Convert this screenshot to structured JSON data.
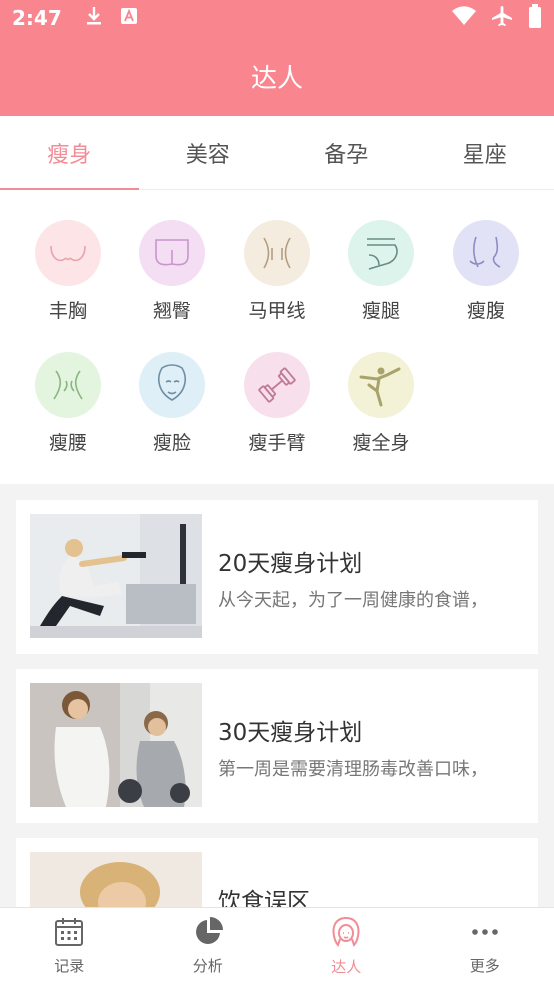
{
  "status_bar": {
    "time": "2:47",
    "icons": [
      "download-icon",
      "a-badge-icon",
      "wifi-icon",
      "airplane-icon",
      "battery-icon"
    ]
  },
  "app_bar": {
    "title": "达人"
  },
  "tabs": [
    {
      "label": "瘦身",
      "active": true
    },
    {
      "label": "美容",
      "active": false
    },
    {
      "label": "备孕",
      "active": false
    },
    {
      "label": "星座",
      "active": false
    }
  ],
  "categories": [
    {
      "label": "丰胸",
      "icon": "chest-icon",
      "color": "#fde4e7"
    },
    {
      "label": "翘臀",
      "icon": "hip-icon",
      "color": "#f3def4"
    },
    {
      "label": "马甲线",
      "icon": "abs-line-icon",
      "color": "#f5ece0"
    },
    {
      "label": "瘦腿",
      "icon": "leg-icon",
      "color": "#ddf4ec"
    },
    {
      "label": "瘦腹",
      "icon": "belly-icon",
      "color": "#e2e2f6"
    },
    {
      "label": "瘦腰",
      "icon": "waist-icon",
      "color": "#e3f5df"
    },
    {
      "label": "瘦脸",
      "icon": "face-icon",
      "color": "#dfeff7"
    },
    {
      "label": "瘦手臂",
      "icon": "dumbbell-icon",
      "color": "#f7e0ec"
    },
    {
      "label": "瘦全身",
      "icon": "yoga-pose-icon",
      "color": "#f3f1d6"
    }
  ],
  "articles": [
    {
      "title": "20天瘦身计划",
      "desc": "从今天起，为了一周健康的食谱，"
    },
    {
      "title": "30天瘦身计划",
      "desc": "第一周是需要清理肠毒改善口味，"
    },
    {
      "title": "饮食误区",
      "desc": ""
    }
  ],
  "bottom_nav": [
    {
      "label": "记录",
      "icon": "calendar-icon",
      "active": false
    },
    {
      "label": "分析",
      "icon": "pie-chart-icon",
      "active": false
    },
    {
      "label": "达人",
      "icon": "expert-avatar-icon",
      "active": true
    },
    {
      "label": "更多",
      "icon": "more-dots-icon",
      "active": false
    }
  ],
  "colors": {
    "primary": "#f9858f",
    "accent": "#f28c96"
  }
}
